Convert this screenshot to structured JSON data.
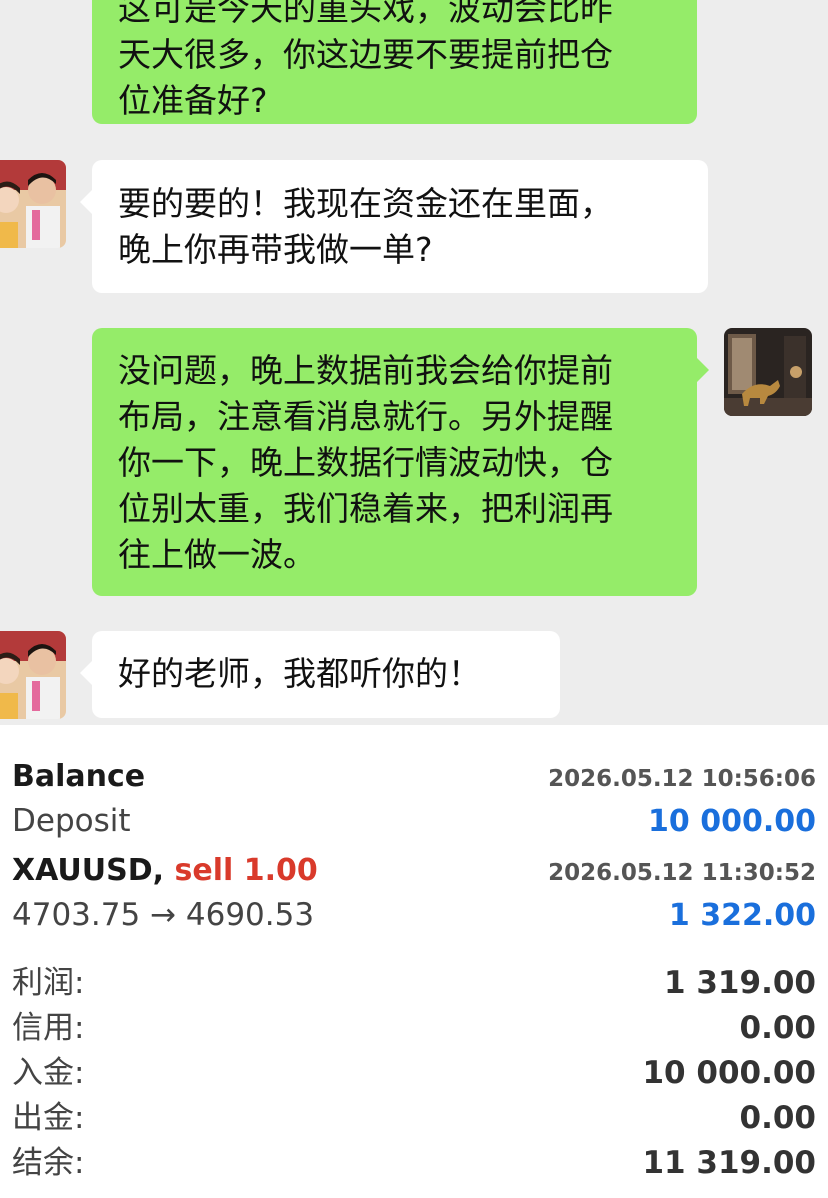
{
  "chat": {
    "messages": [
      {
        "side": "out",
        "lines": [
          "这可是今天的重头戏，波动会比昨",
          "天大很多，你这边要不要提前把仓",
          "位准备好?"
        ]
      },
      {
        "side": "in",
        "lines": [
          "要的要的！我现在资金还在里面，",
          "晚上你再带我做一单?"
        ]
      },
      {
        "side": "out",
        "lines": [
          "没问题，晚上数据前我会给你提前",
          "布局，注意看消息就行。另外提醒",
          "你一下，晚上数据行情波动快，仓",
          "位别太重，我们稳着来，把利润再",
          "往上做一波。"
        ]
      },
      {
        "side": "in",
        "lines": [
          "好的老师，我都听你的！"
        ]
      }
    ]
  },
  "account": {
    "balance_title": "Balance",
    "balance_time": "2026.05.12 10:56:06",
    "deposit_label": "Deposit",
    "deposit_amount": "10 000.00",
    "trade_symbol": "XAUUSD,",
    "trade_side": "sell 1.00",
    "trade_time": "2026.05.12 11:30:52",
    "trade_prices": "4703.75 → 4690.53",
    "trade_profit": "1 322.00",
    "summary": [
      {
        "label": "利润:",
        "value": "1 319.00"
      },
      {
        "label": "信用:",
        "value": "0.00"
      },
      {
        "label": "入金:",
        "value": "10 000.00"
      },
      {
        "label": "出金:",
        "value": "0.00"
      },
      {
        "label": "结余:",
        "value": "11 319.00"
      }
    ]
  },
  "colors": {
    "outgoing_bubble": "#95ec69",
    "incoming_bubble": "#ffffff",
    "chat_background": "#ededed",
    "deposit_blue": "#1a6fdc",
    "sell_red": "#d93a2b"
  }
}
